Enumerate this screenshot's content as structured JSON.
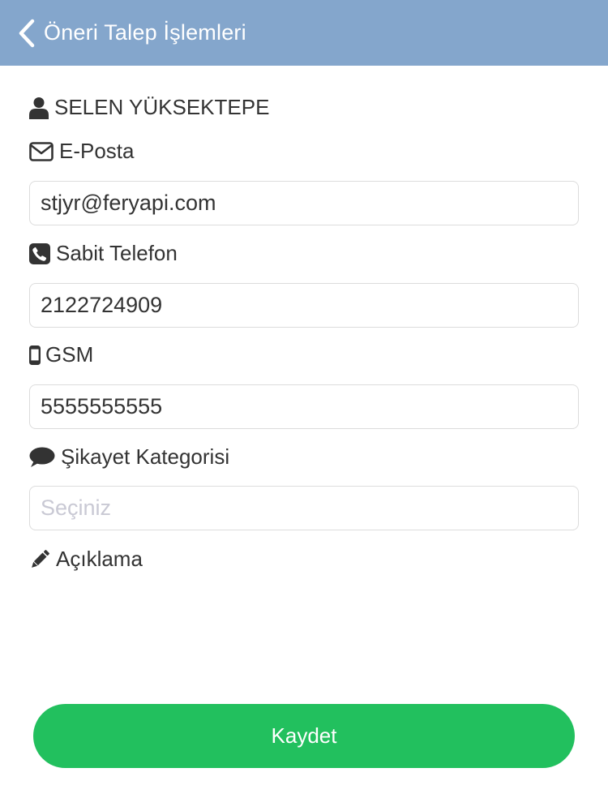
{
  "header": {
    "title": "Öneri Talep İşlemleri",
    "back_icon": "chevron-left-icon",
    "background_color": "#84a6cc"
  },
  "form": {
    "user_name": "SELEN YÜKSEKTEPE",
    "email": {
      "label": "E-Posta",
      "value": "stjyr@feryapi.com",
      "icon": "envelope-icon"
    },
    "landline": {
      "label": "Sabit Telefon",
      "value": "2122724909",
      "icon": "phone-icon"
    },
    "gsm": {
      "label": "GSM",
      "value": "5555555555",
      "icon": "mobile-phone-icon"
    },
    "category": {
      "label": "Şikayet Kategorisi",
      "placeholder": "Seçiniz",
      "icon": "speech-bubble-icon"
    },
    "description": {
      "label": "Açıklama",
      "icon": "pencil-icon"
    }
  },
  "actions": {
    "save_label": "Kaydet",
    "save_color": "#22c05e"
  }
}
